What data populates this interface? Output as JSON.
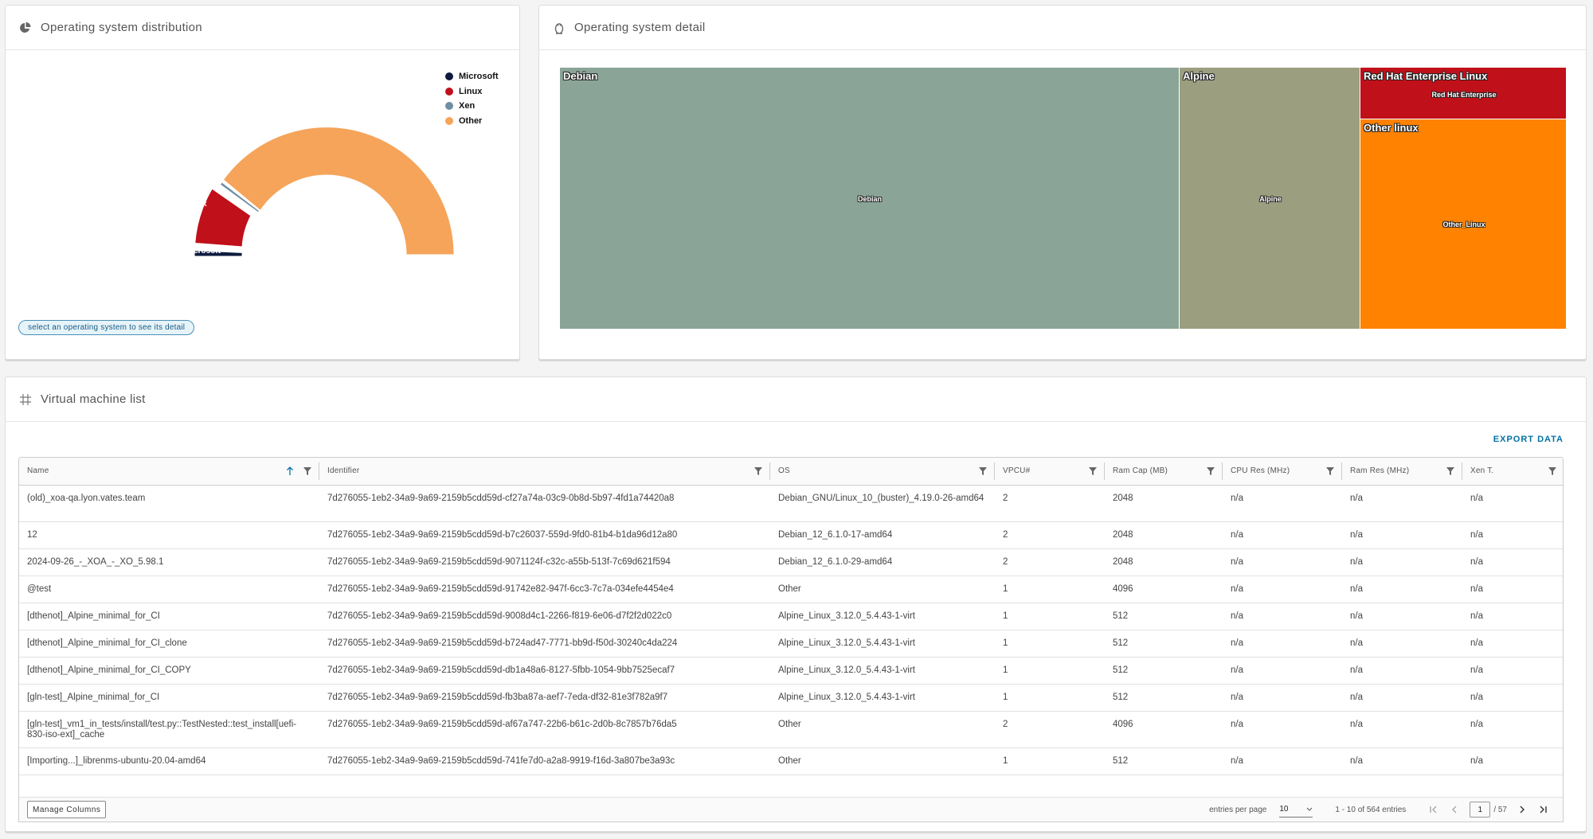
{
  "os_distribution": {
    "title": "Operating system distribution",
    "legend": [
      {
        "label": "Microsoft",
        "color": "#0d1b3e"
      },
      {
        "label": "Linux",
        "color": "#c0101a"
      },
      {
        "label": "Xen",
        "color": "#6f8ea3"
      },
      {
        "label": "Other",
        "color": "#f5a45a"
      }
    ],
    "slice_labels": {
      "linux": "Linux",
      "microsoft": "Microsoft",
      "xen": "A"
    },
    "hint": "select an operating system to see its detail"
  },
  "os_detail": {
    "title": "Operating system detail",
    "tiles": [
      {
        "title": "Debian",
        "label": "Debian",
        "color": "#8aa597"
      },
      {
        "title": "Alpine",
        "label": "Alpine",
        "color": "#9c9e80"
      },
      {
        "title": "Red Hat Enterprise Linux",
        "label": "Red Hat Enterprise",
        "color": "#c0101a"
      },
      {
        "title": "Other linux",
        "label": "Other_Linux",
        "color": "#ff8200"
      }
    ]
  },
  "vm_list": {
    "title": "Virtual machine list",
    "export_label": "EXPORT DATA",
    "columns": [
      "Name",
      "Identifier",
      "OS",
      "VPCU#",
      "Ram Cap (MB)",
      "CPU Res (MHz)",
      "Ram Res (MHz)",
      "Xen T."
    ],
    "rows": [
      [
        "(old)_xoa-qa.lyon.vates.team",
        "7d276055-1eb2-34a9-9a69-2159b5cdd59d-cf27a74a-03c9-0b8d-5b97-4fd1a74420a8",
        "Debian_GNU/Linux_10_(buster)_4.19.0-26-amd64",
        "2",
        "2048",
        "n/a",
        "n/a",
        "n/a"
      ],
      [
        "12",
        "7d276055-1eb2-34a9-9a69-2159b5cdd59d-b7c26037-559d-9fd0-81b4-b1da96d12a80",
        "Debian_12_6.1.0-17-amd64",
        "2",
        "2048",
        "n/a",
        "n/a",
        "n/a"
      ],
      [
        "2024-09-26_-_XOA_-_XO_5.98.1",
        "7d276055-1eb2-34a9-9a69-2159b5cdd59d-9071124f-c32c-a55b-513f-7c69d621f594",
        "Debian_12_6.1.0-29-amd64",
        "2",
        "2048",
        "n/a",
        "n/a",
        "n/a"
      ],
      [
        "@test",
        "7d276055-1eb2-34a9-9a69-2159b5cdd59d-91742e82-947f-6cc3-7c7a-034efe4454e4",
        "Other",
        "1",
        "4096",
        "n/a",
        "n/a",
        "n/a"
      ],
      [
        "[dthenot]_Alpine_minimal_for_CI",
        "7d276055-1eb2-34a9-9a69-2159b5cdd59d-9008d4c1-2266-f819-6e06-d7f2f2d022c0",
        "Alpine_Linux_3.12.0_5.4.43-1-virt",
        "1",
        "512",
        "n/a",
        "n/a",
        "n/a"
      ],
      [
        "[dthenot]_Alpine_minimal_for_CI_clone",
        "7d276055-1eb2-34a9-9a69-2159b5cdd59d-b724ad47-7771-bb9d-f50d-30240c4da224",
        "Alpine_Linux_3.12.0_5.4.43-1-virt",
        "1",
        "512",
        "n/a",
        "n/a",
        "n/a"
      ],
      [
        "[dthenot]_Alpine_minimal_for_CI_COPY",
        "7d276055-1eb2-34a9-9a69-2159b5cdd59d-db1a48a6-8127-5fbb-1054-9bb7525ecaf7",
        "Alpine_Linux_3.12.0_5.4.43-1-virt",
        "1",
        "512",
        "n/a",
        "n/a",
        "n/a"
      ],
      [
        "[gln-test]_Alpine_minimal_for_CI",
        "7d276055-1eb2-34a9-9a69-2159b5cdd59d-fb3ba87a-aef7-7eda-df32-81e3f782a9f7",
        "Alpine_Linux_3.12.0_5.4.43-1-virt",
        "1",
        "512",
        "n/a",
        "n/a",
        "n/a"
      ],
      [
        "[gln-test]_vm1_in_tests/install/test.py::TestNested::test_install[uefi-830-iso-ext]_cache",
        "7d276055-1eb2-34a9-9a69-2159b5cdd59d-af67a747-22b6-b61c-2d0b-8c7857b76da5",
        "Other",
        "2",
        "4096",
        "n/a",
        "n/a",
        "n/a"
      ],
      [
        "[Importing...]_librenms-ubuntu-20.04-amd64",
        "7d276055-1eb2-34a9-9a69-2159b5cdd59d-741fe7d0-a2a8-9919-f16d-3a807be3a93c",
        "Other",
        "1",
        "512",
        "n/a",
        "n/a",
        "n/a"
      ]
    ],
    "footer": {
      "manage_columns": "Manage Columns",
      "entries_per_page_label": "entries per page",
      "entries_per_page": "10",
      "range": "1 - 10 of 564 entries",
      "page": "1",
      "total_pages": "/ 57"
    }
  }
}
